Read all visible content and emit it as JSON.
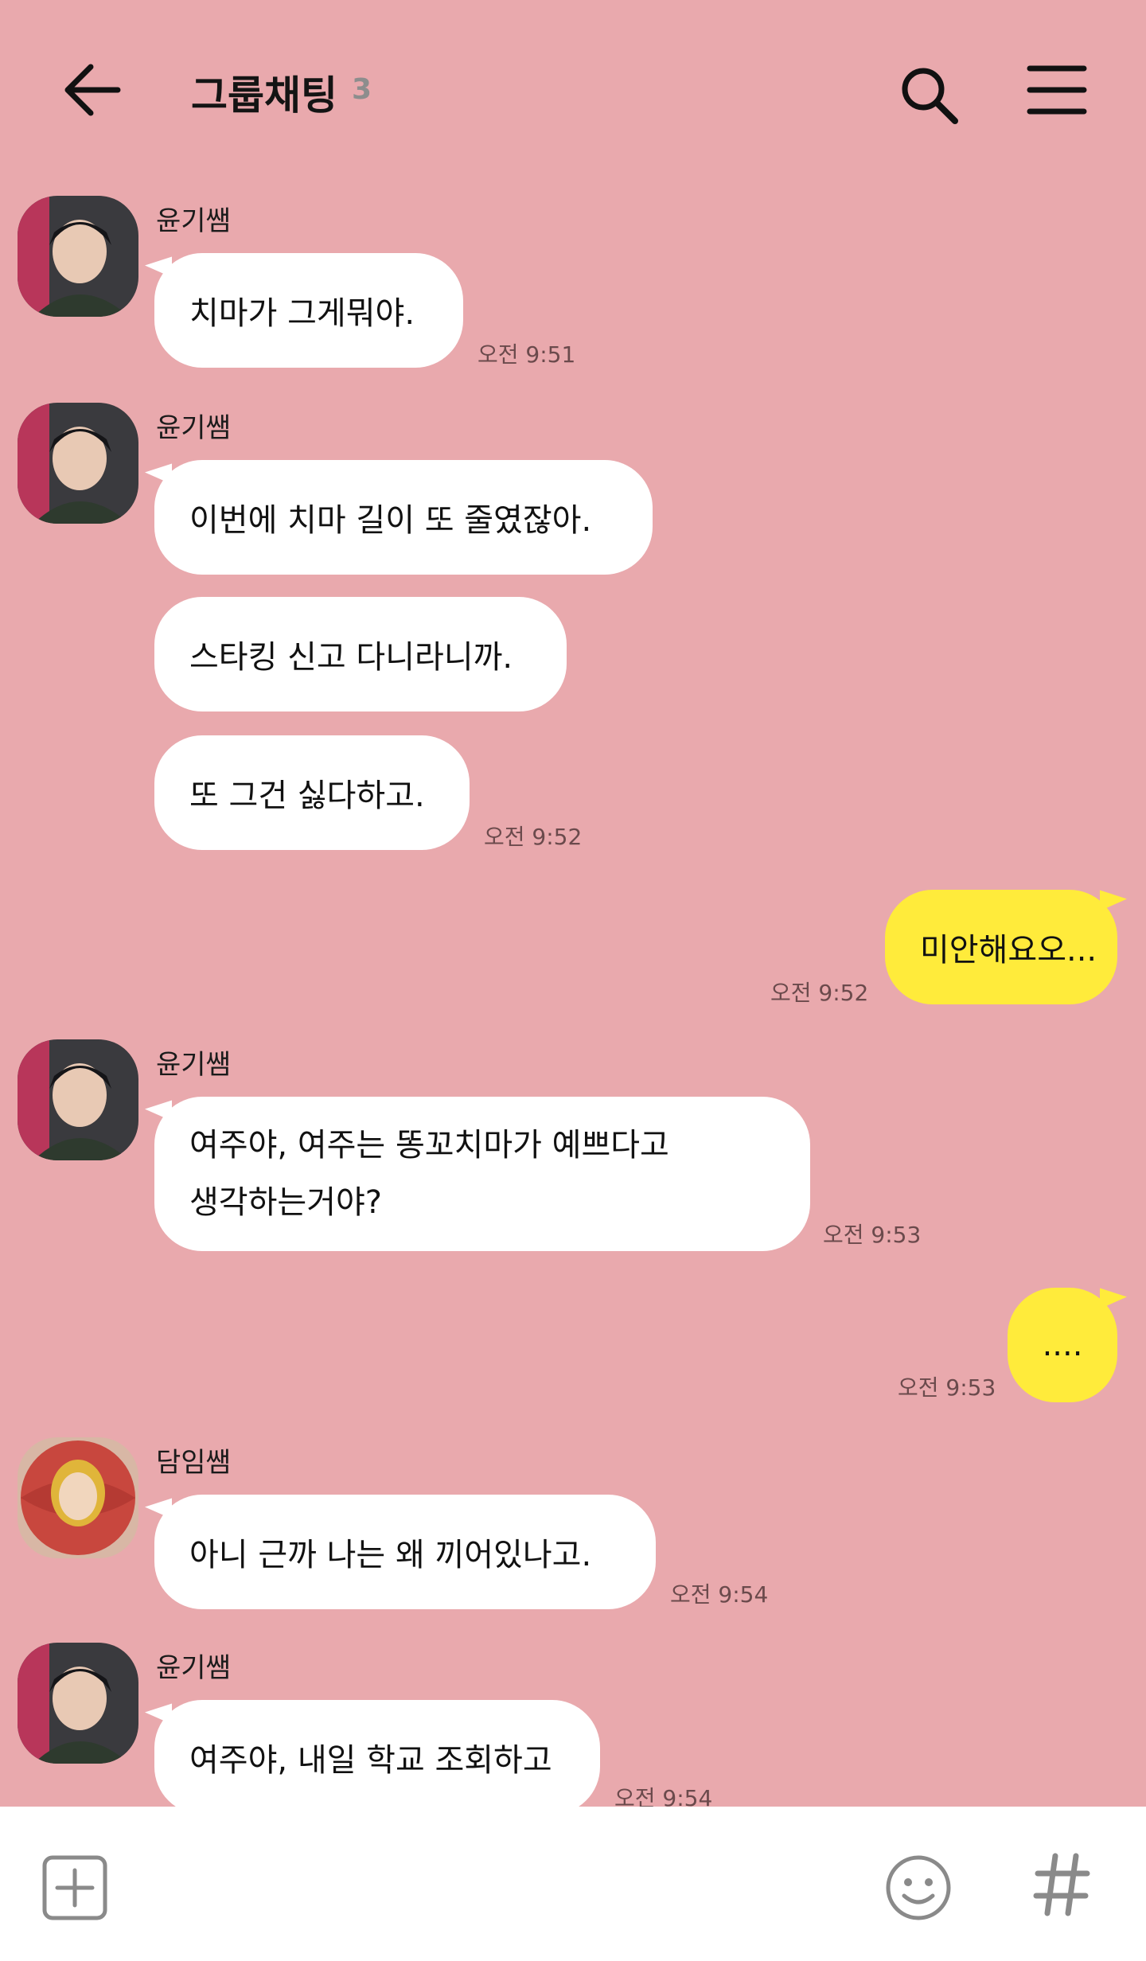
{
  "header": {
    "title": "그룹채팅",
    "member_count": "3"
  },
  "messages": [
    {
      "sender": "윤기쌤",
      "lines": [
        "치마가 그게뭐야."
      ],
      "time": "오전 9:51"
    },
    {
      "sender": "윤기쌤",
      "lines": [
        "이번에 치마 길이 또 줄였잖아.",
        "스타킹 신고 다니라니까.",
        "또 그건 싫다하고."
      ],
      "time": "오전 9:52"
    },
    {
      "sender": "me",
      "lines": [
        "미안해요오..."
      ],
      "time": "오전 9:52"
    },
    {
      "sender": "윤기쌤",
      "lines": [
        "여주야, 여주는 똥꼬치마가 예쁘다고\n생각하는거야?"
      ],
      "time": "오전 9:53"
    },
    {
      "sender": "me",
      "lines": [
        "...."
      ],
      "time": "오전 9:53"
    },
    {
      "sender": "담임쌤",
      "lines": [
        "아니 근까 나는 왜 끼어있나고."
      ],
      "time": "오전 9:54"
    },
    {
      "sender": "윤기쌤",
      "lines": [
        "여주야, 내일 학교 조회하고"
      ],
      "time": "오전 9:54"
    }
  ],
  "ui": {
    "m1_sender": "윤기쌤",
    "m1_text": "치마가 그게뭐야.",
    "m1_time": "오전 9:51",
    "m2_sender": "윤기쌤",
    "m2_text_a": "이번에 치마 길이 또 줄였잖아.",
    "m2_text_b": "스타킹 신고 다니라니까.",
    "m2_text_c": "또 그건 싫다하고.",
    "m2_time": "오전 9:52",
    "m3_text": "미안해요오...",
    "m3_time": "오전 9:52",
    "m4_sender": "윤기쌤",
    "m4_line1": "여주야, 여주는 똥꼬치마가 예쁘다고",
    "m4_line2": "생각하는거야?",
    "m4_time": "오전 9:53",
    "m5_text": "....",
    "m5_time": "오전 9:53",
    "m6_sender": "담임쌤",
    "m6_text": "아니 근까 나는 왜 끼어있나고.",
    "m6_time": "오전 9:54",
    "m7_sender": "윤기쌤",
    "m7_text": "여주야, 내일 학교 조회하고",
    "m7_time": "오전 9:54"
  },
  "icons": {
    "back": "arrow-left-icon",
    "search": "search-icon",
    "menu": "hamburger-menu-icon",
    "plus": "plus-box-icon",
    "emoji": "emoji-icon",
    "hashtag": "hashtag-icon"
  },
  "colors": {
    "background": "#E9A9AD",
    "my_bubble": "#FFEB3B",
    "other_bubble": "#FFFFFF"
  }
}
